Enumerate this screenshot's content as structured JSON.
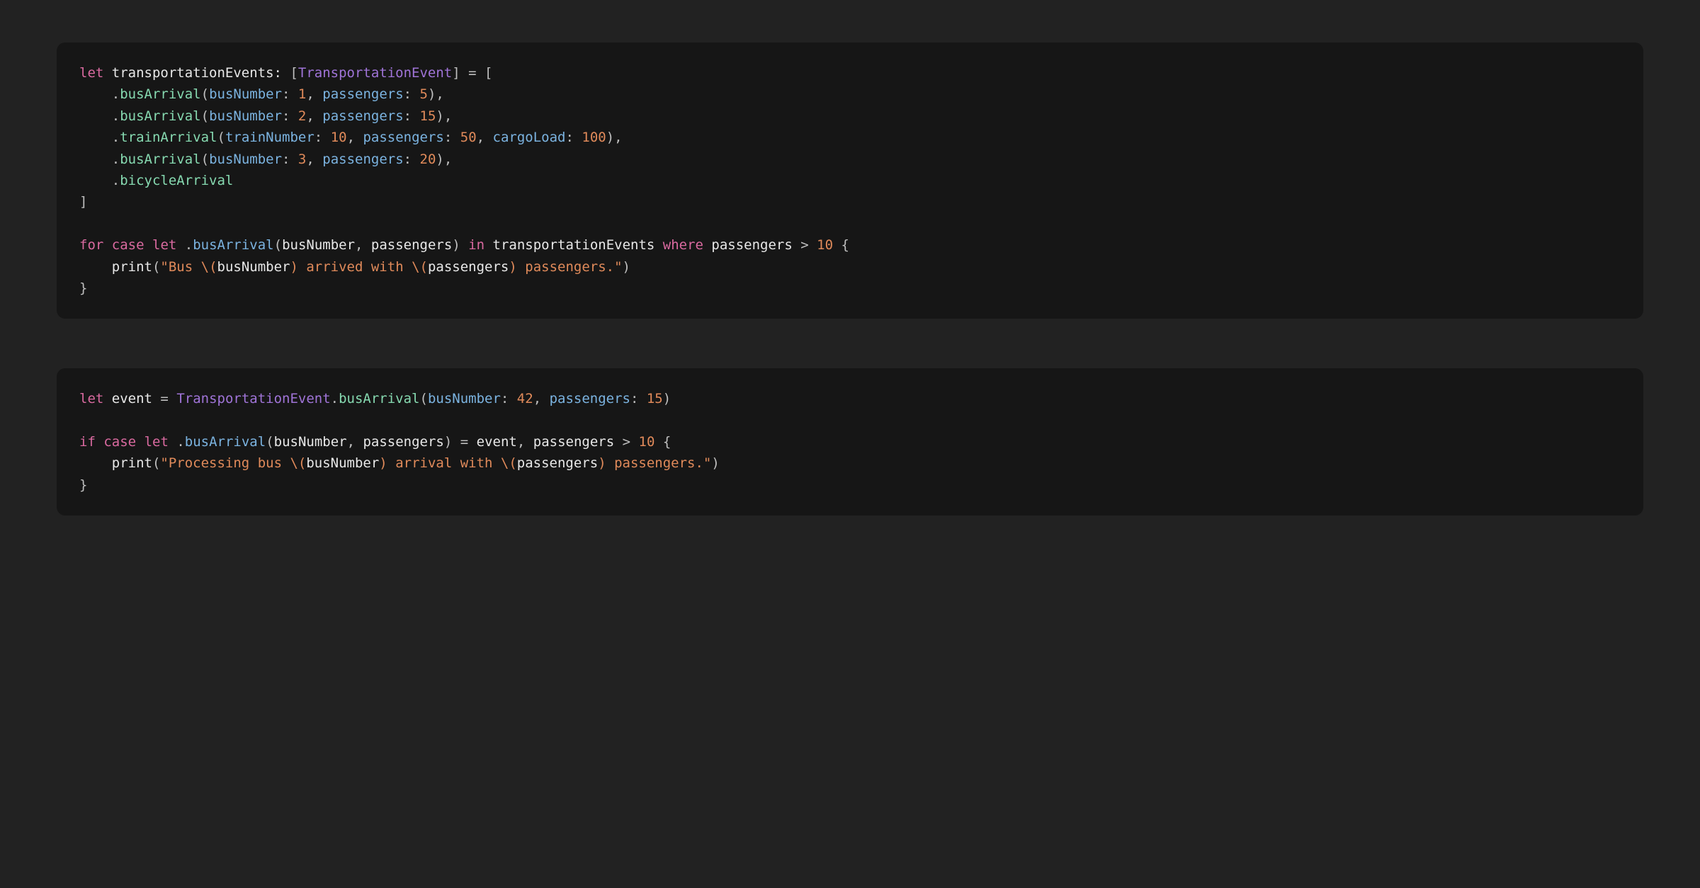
{
  "colors": {
    "keyword": "#da6aa0",
    "type": "#a074d8",
    "member": "#86d9b0",
    "label": "#7bb3e0",
    "number": "#e08a5a",
    "string": "#e08a5a",
    "punct": "#bfbfbf",
    "default": "#e8e8e8",
    "bg": "#222222",
    "block_bg": "#161616"
  },
  "blocks": [
    {
      "id": "transportation-events-array",
      "lines": [
        [
          {
            "cls": "kw",
            "t": "let"
          },
          {
            "cls": "def",
            "t": " transportationEvents: "
          },
          {
            "cls": "punc",
            "t": "["
          },
          {
            "cls": "type",
            "t": "TransportationEvent"
          },
          {
            "cls": "punc",
            "t": "]"
          },
          {
            "cls": "def",
            "t": " "
          },
          {
            "cls": "punc",
            "t": "="
          },
          {
            "cls": "def",
            "t": " "
          },
          {
            "cls": "punc",
            "t": "["
          }
        ],
        [
          {
            "cls": "def",
            "t": "    "
          },
          {
            "cls": "punc",
            "t": "."
          },
          {
            "cls": "memb",
            "t": "busArrival"
          },
          {
            "cls": "punc",
            "t": "("
          },
          {
            "cls": "lbl",
            "t": "busNumber"
          },
          {
            "cls": "punc",
            "t": ": "
          },
          {
            "cls": "num",
            "t": "1"
          },
          {
            "cls": "punc",
            "t": ", "
          },
          {
            "cls": "lbl",
            "t": "passengers"
          },
          {
            "cls": "punc",
            "t": ": "
          },
          {
            "cls": "num",
            "t": "5"
          },
          {
            "cls": "punc",
            "t": "),"
          }
        ],
        [
          {
            "cls": "def",
            "t": "    "
          },
          {
            "cls": "punc",
            "t": "."
          },
          {
            "cls": "memb",
            "t": "busArrival"
          },
          {
            "cls": "punc",
            "t": "("
          },
          {
            "cls": "lbl",
            "t": "busNumber"
          },
          {
            "cls": "punc",
            "t": ": "
          },
          {
            "cls": "num",
            "t": "2"
          },
          {
            "cls": "punc",
            "t": ", "
          },
          {
            "cls": "lbl",
            "t": "passengers"
          },
          {
            "cls": "punc",
            "t": ": "
          },
          {
            "cls": "num",
            "t": "15"
          },
          {
            "cls": "punc",
            "t": "),"
          }
        ],
        [
          {
            "cls": "def",
            "t": "    "
          },
          {
            "cls": "punc",
            "t": "."
          },
          {
            "cls": "memb",
            "t": "trainArrival"
          },
          {
            "cls": "punc",
            "t": "("
          },
          {
            "cls": "lbl",
            "t": "trainNumber"
          },
          {
            "cls": "punc",
            "t": ": "
          },
          {
            "cls": "num",
            "t": "10"
          },
          {
            "cls": "punc",
            "t": ", "
          },
          {
            "cls": "lbl",
            "t": "passengers"
          },
          {
            "cls": "punc",
            "t": ": "
          },
          {
            "cls": "num",
            "t": "50"
          },
          {
            "cls": "punc",
            "t": ", "
          },
          {
            "cls": "lbl",
            "t": "cargoLoad"
          },
          {
            "cls": "punc",
            "t": ": "
          },
          {
            "cls": "num",
            "t": "100"
          },
          {
            "cls": "punc",
            "t": "),"
          }
        ],
        [
          {
            "cls": "def",
            "t": "    "
          },
          {
            "cls": "punc",
            "t": "."
          },
          {
            "cls": "memb",
            "t": "busArrival"
          },
          {
            "cls": "punc",
            "t": "("
          },
          {
            "cls": "lbl",
            "t": "busNumber"
          },
          {
            "cls": "punc",
            "t": ": "
          },
          {
            "cls": "num",
            "t": "3"
          },
          {
            "cls": "punc",
            "t": ", "
          },
          {
            "cls": "lbl",
            "t": "passengers"
          },
          {
            "cls": "punc",
            "t": ": "
          },
          {
            "cls": "num",
            "t": "20"
          },
          {
            "cls": "punc",
            "t": "),"
          }
        ],
        [
          {
            "cls": "def",
            "t": "    "
          },
          {
            "cls": "punc",
            "t": "."
          },
          {
            "cls": "memb",
            "t": "bicycleArrival"
          }
        ],
        [
          {
            "cls": "punc",
            "t": "]"
          }
        ],
        [
          {
            "cls": "def",
            "t": ""
          }
        ],
        [
          {
            "cls": "kw",
            "t": "for"
          },
          {
            "cls": "def",
            "t": " "
          },
          {
            "cls": "kw",
            "t": "case"
          },
          {
            "cls": "def",
            "t": " "
          },
          {
            "cls": "kw",
            "t": "let"
          },
          {
            "cls": "def",
            "t": " "
          },
          {
            "cls": "punc",
            "t": "."
          },
          {
            "cls": "lbl",
            "t": "busArrival"
          },
          {
            "cls": "punc",
            "t": "("
          },
          {
            "cls": "def",
            "t": "busNumber"
          },
          {
            "cls": "punc",
            "t": ", "
          },
          {
            "cls": "def",
            "t": "passengers"
          },
          {
            "cls": "punc",
            "t": ")"
          },
          {
            "cls": "def",
            "t": " "
          },
          {
            "cls": "kw",
            "t": "in"
          },
          {
            "cls": "def",
            "t": " transportationEvents "
          },
          {
            "cls": "kw",
            "t": "where"
          },
          {
            "cls": "def",
            "t": " passengers "
          },
          {
            "cls": "punc",
            "t": ">"
          },
          {
            "cls": "def",
            "t": " "
          },
          {
            "cls": "num",
            "t": "10"
          },
          {
            "cls": "def",
            "t": " "
          },
          {
            "cls": "punc",
            "t": "{"
          }
        ],
        [
          {
            "cls": "def",
            "t": "    "
          },
          {
            "cls": "fn",
            "t": "print"
          },
          {
            "cls": "punc",
            "t": "("
          },
          {
            "cls": "str",
            "t": "\"Bus "
          },
          {
            "cls": "intp",
            "t": "\\("
          },
          {
            "cls": "def",
            "t": "busNumber"
          },
          {
            "cls": "intp",
            "t": ")"
          },
          {
            "cls": "str",
            "t": " arrived with "
          },
          {
            "cls": "intp",
            "t": "\\("
          },
          {
            "cls": "def",
            "t": "passengers"
          },
          {
            "cls": "intp",
            "t": ")"
          },
          {
            "cls": "str",
            "t": " passengers.\""
          },
          {
            "cls": "punc",
            "t": ")"
          }
        ],
        [
          {
            "cls": "punc",
            "t": "}"
          }
        ]
      ]
    },
    {
      "id": "if-case-let-event",
      "lines": [
        [
          {
            "cls": "kw",
            "t": "let"
          },
          {
            "cls": "def",
            "t": " event "
          },
          {
            "cls": "punc",
            "t": "="
          },
          {
            "cls": "def",
            "t": " "
          },
          {
            "cls": "type",
            "t": "TransportationEvent"
          },
          {
            "cls": "punc",
            "t": "."
          },
          {
            "cls": "memb",
            "t": "busArrival"
          },
          {
            "cls": "punc",
            "t": "("
          },
          {
            "cls": "lbl",
            "t": "busNumber"
          },
          {
            "cls": "punc",
            "t": ": "
          },
          {
            "cls": "num",
            "t": "42"
          },
          {
            "cls": "punc",
            "t": ", "
          },
          {
            "cls": "lbl",
            "t": "passengers"
          },
          {
            "cls": "punc",
            "t": ": "
          },
          {
            "cls": "num",
            "t": "15"
          },
          {
            "cls": "punc",
            "t": ")"
          }
        ],
        [
          {
            "cls": "def",
            "t": ""
          }
        ],
        [
          {
            "cls": "kw",
            "t": "if"
          },
          {
            "cls": "def",
            "t": " "
          },
          {
            "cls": "kw",
            "t": "case"
          },
          {
            "cls": "def",
            "t": " "
          },
          {
            "cls": "kw",
            "t": "let"
          },
          {
            "cls": "def",
            "t": " "
          },
          {
            "cls": "punc",
            "t": "."
          },
          {
            "cls": "lbl",
            "t": "busArrival"
          },
          {
            "cls": "punc",
            "t": "("
          },
          {
            "cls": "def",
            "t": "busNumber"
          },
          {
            "cls": "punc",
            "t": ", "
          },
          {
            "cls": "def",
            "t": "passengers"
          },
          {
            "cls": "punc",
            "t": ")"
          },
          {
            "cls": "def",
            "t": " "
          },
          {
            "cls": "punc",
            "t": "="
          },
          {
            "cls": "def",
            "t": " event"
          },
          {
            "cls": "punc",
            "t": ", "
          },
          {
            "cls": "def",
            "t": "passengers "
          },
          {
            "cls": "punc",
            "t": ">"
          },
          {
            "cls": "def",
            "t": " "
          },
          {
            "cls": "num",
            "t": "10"
          },
          {
            "cls": "def",
            "t": " "
          },
          {
            "cls": "punc",
            "t": "{"
          }
        ],
        [
          {
            "cls": "def",
            "t": "    "
          },
          {
            "cls": "fn",
            "t": "print"
          },
          {
            "cls": "punc",
            "t": "("
          },
          {
            "cls": "str",
            "t": "\"Processing bus "
          },
          {
            "cls": "intp",
            "t": "\\("
          },
          {
            "cls": "def",
            "t": "busNumber"
          },
          {
            "cls": "intp",
            "t": ")"
          },
          {
            "cls": "str",
            "t": " arrival with "
          },
          {
            "cls": "intp",
            "t": "\\("
          },
          {
            "cls": "def",
            "t": "passengers"
          },
          {
            "cls": "intp",
            "t": ")"
          },
          {
            "cls": "str",
            "t": " passengers.\""
          },
          {
            "cls": "punc",
            "t": ")"
          }
        ],
        [
          {
            "cls": "punc",
            "t": "}"
          }
        ]
      ]
    }
  ]
}
